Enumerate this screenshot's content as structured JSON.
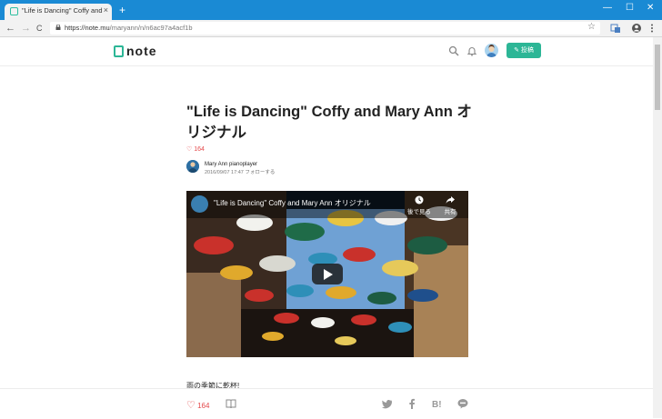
{
  "browser": {
    "tab_title": "\"Life is Dancing\" Coffy and Mary",
    "tab_close": "×",
    "new_tab": "+",
    "win_min": "—",
    "win_max": "☐",
    "win_close": "✕",
    "back": "←",
    "forward": "→",
    "reload": "C",
    "url_main": "https://note.mu",
    "url_path": "/maryann/n/n6ac97a4acf1b",
    "star": "☆"
  },
  "site": {
    "logo": "note",
    "post_button": "✎ 投稿"
  },
  "article": {
    "title": "\"Life is Dancing\" Coffy and Mary Ann オリジナル",
    "likes": "164",
    "author": "Mary Ann pianoplayer",
    "date": "2016/09/07 17:47",
    "follow": "フォローする",
    "body_first_line": "雨の季節に乾杯!"
  },
  "video": {
    "title": "\"Life is Dancing\" Coffy and Mary Ann オリジナル",
    "watch_later": "後で見る",
    "share": "共有"
  },
  "footer": {
    "likes": "164"
  },
  "colors": {
    "accent": "#2cb696",
    "like": "#e4494b",
    "titlebar": "#1a8ad4"
  }
}
